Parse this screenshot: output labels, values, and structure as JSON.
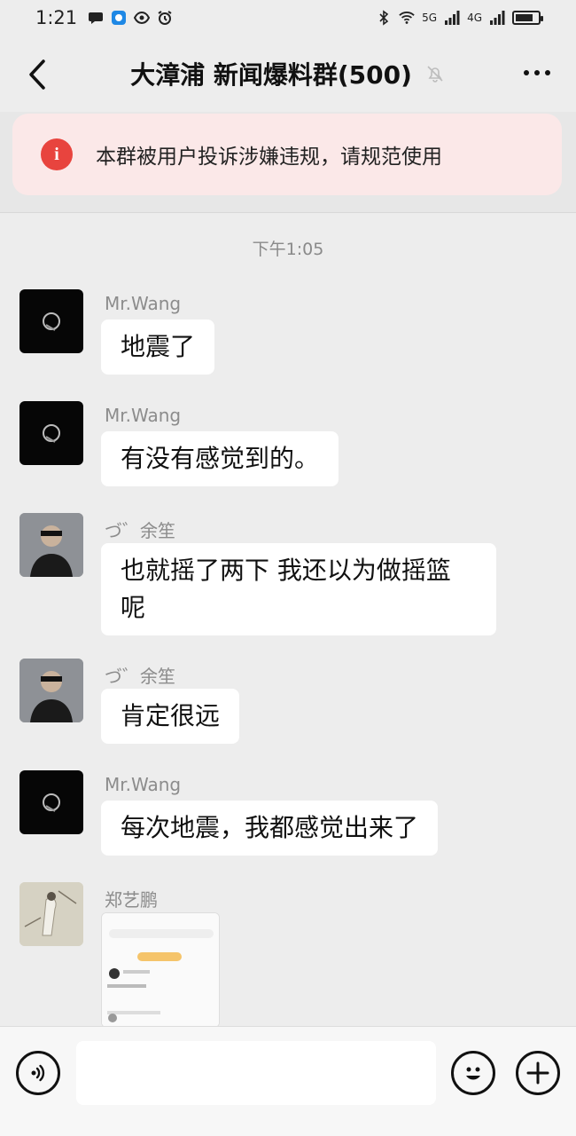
{
  "status_bar": {
    "time": "1:21",
    "signal_1": "5G",
    "signal_2": "4G",
    "battery_level": 0.8
  },
  "header": {
    "title": "大漳浦 新闻爆料群(500)"
  },
  "notice": {
    "text": "本群被用户投诉涉嫌违规，请规范使用"
  },
  "chat": {
    "timestamp": "下午1:05",
    "messages": [
      {
        "sender": "Mr.Wang",
        "text": "地震了",
        "avatar": "black"
      },
      {
        "sender": "Mr.Wang",
        "text": "有没有感觉到的。",
        "avatar": "black"
      },
      {
        "sender": "づ゛余笙",
        "text": "也就摇了两下 我还以为做摇篮\n呢",
        "avatar": "man"
      },
      {
        "sender": "づ゛余笙",
        "text": "肯定很远",
        "avatar": "man"
      },
      {
        "sender": "Mr.Wang",
        "text": "每次地震，我都感觉出来了",
        "avatar": "black"
      },
      {
        "sender": "郑艺鹏",
        "text": "",
        "avatar": "art"
      }
    ]
  },
  "colors": {
    "background": "#ededed",
    "notice_bg": "#fbe8e8",
    "notice_icon": "#e8443e",
    "bubble": "#ffffff",
    "input_bar": "#f7f7f7"
  }
}
